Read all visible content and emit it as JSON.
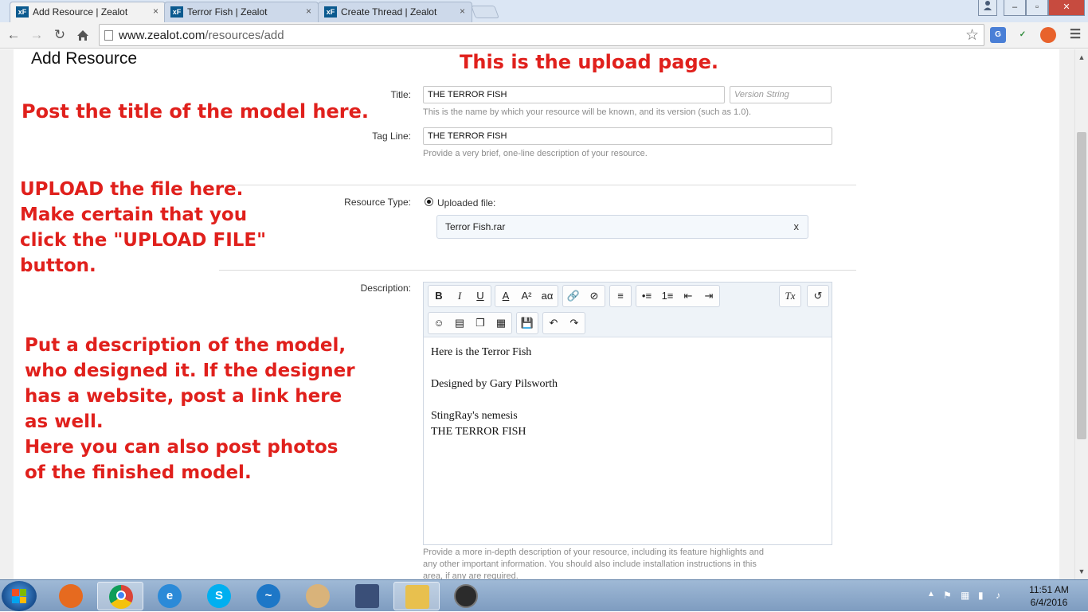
{
  "browser": {
    "tabs": [
      {
        "icon": "xF",
        "title": "Add Resource | Zealot",
        "active": true
      },
      {
        "icon": "xF",
        "title": "Terror Fish | Zealot",
        "active": false
      },
      {
        "icon": "xF",
        "title": "Create Thread | Zealot",
        "active": false
      }
    ],
    "tab_close_glyph": "×",
    "url_host": "www.zealot.com",
    "url_path": "/resources/add",
    "window_controls": {
      "minimize": "‒",
      "maximize": "▫",
      "close": "✕"
    }
  },
  "page": {
    "heading": "Add Resource",
    "title_field": {
      "label": "Title:",
      "value": "THE TERROR FISH",
      "version_placeholder": "Version String",
      "hint": "This is the name by which your resource will be known, and its version (such as 1.0)."
    },
    "tagline_field": {
      "label": "Tag Line:",
      "value": "THE TERROR FISH",
      "hint": "Provide a very brief, one-line description of your resource."
    },
    "resource_type": {
      "label": "Resource Type:",
      "option": "Uploaded file:",
      "file_name": "Terror Fish.rar",
      "remove_glyph": "x"
    },
    "description": {
      "label": "Description:",
      "body": [
        "Here is the Terror Fish",
        "",
        "Designed by Gary Pilsworth",
        "",
        "StingRay's nemesis",
        "THE TERROR FISH"
      ],
      "hint_lines": [
        "Provide a more in-depth description of your resource, including its feature highlights and",
        "any other important information. You should also include installation instructions in this",
        "area, if any are required."
      ]
    },
    "editor_toolbar": {
      "bold": "B",
      "italic": "I",
      "underline": "U",
      "font_color": "A",
      "font_size": "A²",
      "font_family": "aα",
      "remove_format": "Tx"
    }
  },
  "annotations": {
    "upload_page": "This is the upload page.",
    "title_note": "Post the title of the model here.",
    "upload_note": [
      "UPLOAD the file here.",
      "Make certain that you",
      "click the \"UPLOAD FILE\"",
      "button."
    ],
    "description_note": [
      "Put a description of the model,",
      "who designed it. If the designer",
      "has a website, post a link here",
      "as well.",
      "Here you can also post photos",
      "of the finished model."
    ]
  },
  "taskbar": {
    "time": "11:51 AM",
    "date": "6/4/2016"
  },
  "colors": {
    "annotation": "#e0201c",
    "tab_active": "#f2f2f2",
    "taskbar": "#8fabcd"
  }
}
